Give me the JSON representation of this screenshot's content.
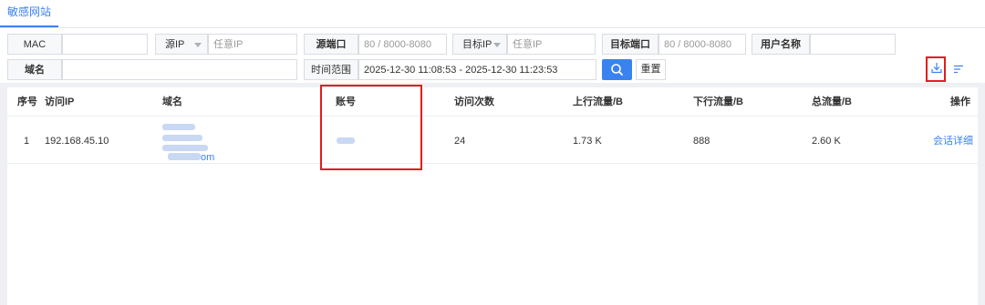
{
  "tabs": [
    {
      "label": "敏感网站",
      "active": true
    }
  ],
  "filters": {
    "mac_label": "MAC",
    "mac_value": "",
    "src_ip_select": "源IP",
    "src_ip_placeholder": "任意IP",
    "src_port_label": "源端口",
    "src_port_placeholder": "80 / 8000-8080",
    "dst_ip_select": "目标IP",
    "dst_ip_placeholder": "任意IP",
    "dst_port_label": "目标端口",
    "dst_port_placeholder": "80 / 8000-8080",
    "username_label": "用户名称",
    "username_value": "",
    "domain_label": "域名",
    "domain_value": "",
    "time_range_label": "时间范围",
    "time_range_value": "2025-12-30 11:08:53 - 2025-12-30 11:23:53",
    "reset_label": "重置"
  },
  "icons": {
    "search": "search-icon",
    "download": "download-icon",
    "sort": "sort-icon"
  },
  "table": {
    "columns": [
      "序号",
      "访问IP",
      "域名",
      "账号",
      "访问次数",
      "上行流量/B",
      "下行流量/B",
      "总流量/B",
      "操作"
    ],
    "rows": [
      {
        "index": "1",
        "ip": "192.168.45.10",
        "domain_visible_suffix": "om",
        "account": "",
        "visits": "24",
        "upload": "1.73 K",
        "download": "888",
        "total": "2.60 K",
        "action": "会话详细"
      }
    ]
  },
  "colors": {
    "accent": "#3a82f0",
    "highlight_box": "#e31c1c"
  }
}
